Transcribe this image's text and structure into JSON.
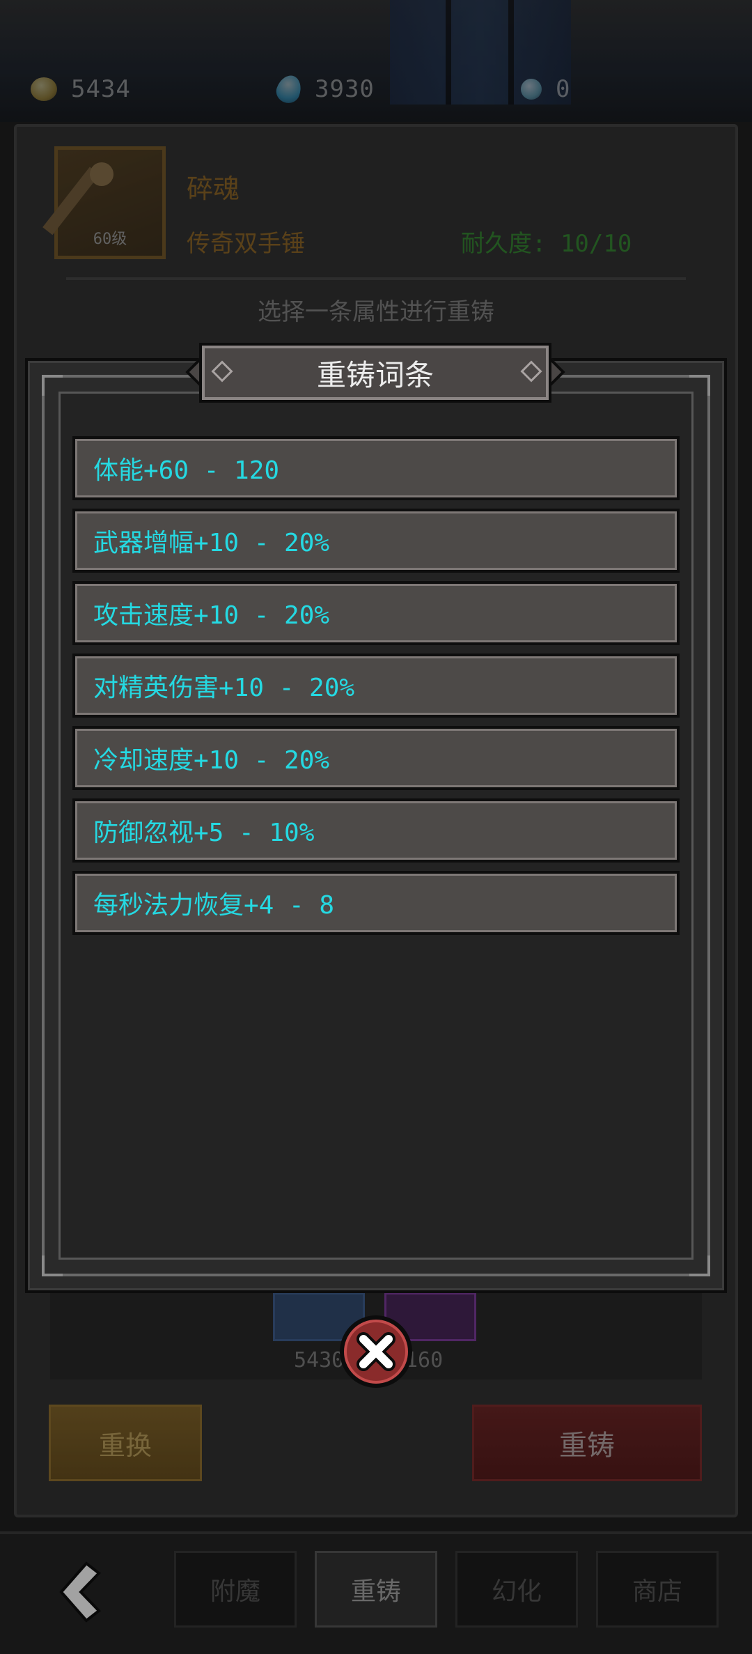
{
  "resources": {
    "gold": "5434",
    "gems": "3930",
    "orbs": "0"
  },
  "item": {
    "name": "碎魂",
    "type": "传奇双手锤",
    "durability": "耐久度: 10/10",
    "level": "60级"
  },
  "hint": "选择一条属性进行重铸",
  "modal": {
    "title": "重铸词条",
    "options": [
      "体能+60 - 120",
      "武器增幅+10 - 20%",
      "攻击速度+10 - 20%",
      "对精英伤害+10 - 20%",
      "冷却速度+10 - 20%",
      "防御忽视+5 - 10%",
      "每秒法力恢复+4 - 8"
    ]
  },
  "cost": {
    "gold": "5430",
    "gem": "160"
  },
  "actions": {
    "swap": "重换",
    "reforge": "重铸"
  },
  "tabs": [
    "附魔",
    "重铸",
    "幻化",
    "商店"
  ],
  "active_tab": "重铸",
  "colors": {
    "option_text": "#25d9e2",
    "gold_text": "#8d6321",
    "durability_text": "#2f7a2c",
    "reforge_button": "#5c2020",
    "swap_button": "#6e5524"
  },
  "icons": {
    "gold": "gold-coin-icon",
    "gem": "blue-gem-icon",
    "orb": "orb-icon",
    "item": "hammer-icon",
    "close": "close-x-icon",
    "back": "back-arrow-icon"
  }
}
